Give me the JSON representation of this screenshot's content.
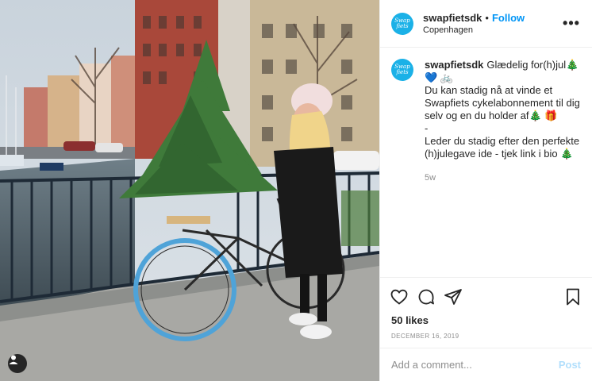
{
  "header": {
    "username": "swapfietsdk",
    "separator": "•",
    "follow_label": "Follow",
    "location": "Copenhagen",
    "more_label": "•••",
    "avatar_text": "Swap fiets"
  },
  "caption": {
    "username": "swapfietsdk",
    "lines": [
      "Glædelig for(h)jul🎄 💙 🚲",
      "Du kan stadig nå at vinde et Swapfiets cykelabonnement til dig selv og en du holder af🎄 🎁",
      "-",
      "Leder du stadig efter den perfekte (h)julegave ide - tjek link i bio 🎄"
    ],
    "time": "5w"
  },
  "actions": {
    "icons": [
      "heart-icon",
      "comment-icon",
      "share-icon",
      "bookmark-icon"
    ],
    "likes": "50 likes",
    "date": "DECEMBER 16, 2019"
  },
  "comment_box": {
    "placeholder": "Add a comment...",
    "post_label": "Post"
  },
  "colors": {
    "accent": "#0095f6",
    "brand": "#1bb1e7",
    "muted": "#8e8e8e"
  }
}
